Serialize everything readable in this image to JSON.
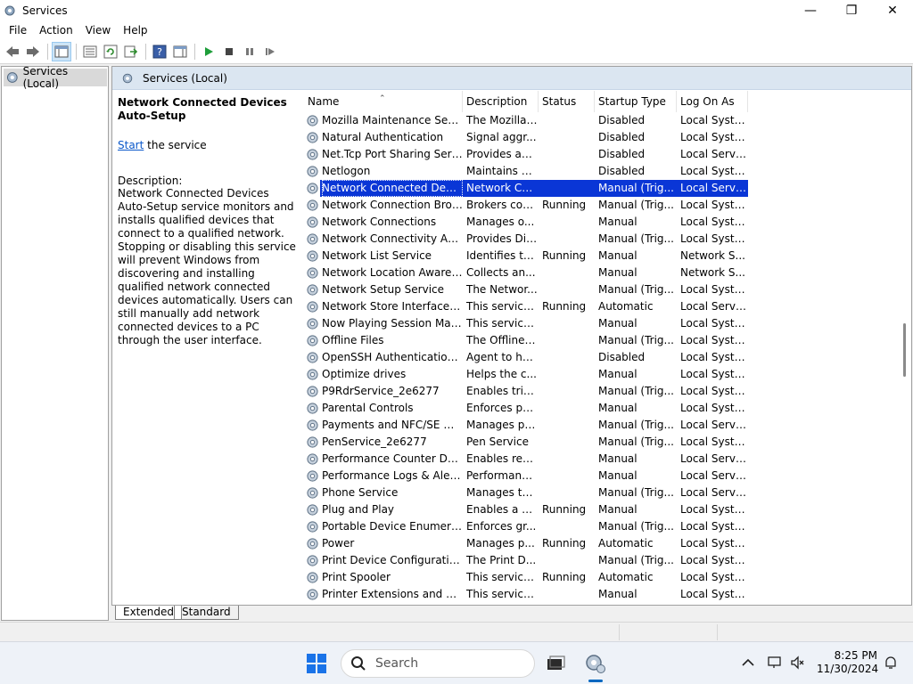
{
  "window": {
    "title": "Services"
  },
  "menu": [
    "File",
    "Action",
    "View",
    "Help"
  ],
  "tree": {
    "root_label": "Services (Local)"
  },
  "header": {
    "label": "Services (Local)"
  },
  "detail": {
    "service_name": "Network Connected Devices Auto-Setup",
    "action_link": "Start",
    "action_suffix": " the service",
    "description_label": "Description:",
    "description": "Network Connected Devices Auto-Setup service monitors and installs qualified devices that connect to a qualified network. Stopping or disabling this service will prevent Windows from discovering and installing qualified network connected devices automatically. Users can still manually add network connected devices to a PC through the user interface."
  },
  "columns": [
    "Name",
    "Description",
    "Status",
    "Startup Type",
    "Log On As"
  ],
  "rows": [
    {
      "name": "Mozilla Maintenance Service",
      "description": "The Mozilla ...",
      "status": "",
      "startup": "Disabled",
      "logon": "Local Syste..."
    },
    {
      "name": "Natural Authentication",
      "description": "Signal aggr...",
      "status": "",
      "startup": "Disabled",
      "logon": "Local Syste..."
    },
    {
      "name": "Net.Tcp Port Sharing Service",
      "description": "Provides abi...",
      "status": "",
      "startup": "Disabled",
      "logon": "Local Service"
    },
    {
      "name": "Netlogon",
      "description": "Maintains a ...",
      "status": "",
      "startup": "Disabled",
      "logon": "Local Syste..."
    },
    {
      "name": "Network Connected Device...",
      "description": "Network Co...",
      "status": "",
      "startup": "Manual (Trig...",
      "logon": "Local Service",
      "selected": true
    },
    {
      "name": "Network Connection Broker",
      "description": "Brokers con...",
      "status": "Running",
      "startup": "Manual (Trig...",
      "logon": "Local Syste..."
    },
    {
      "name": "Network Connections",
      "description": "Manages o...",
      "status": "",
      "startup": "Manual",
      "logon": "Local Syste..."
    },
    {
      "name": "Network Connectivity Assis...",
      "description": "Provides Dir...",
      "status": "",
      "startup": "Manual (Trig...",
      "logon": "Local Syste..."
    },
    {
      "name": "Network List Service",
      "description": "Identifies th...",
      "status": "Running",
      "startup": "Manual",
      "logon": "Network S..."
    },
    {
      "name": "Network Location Awareness",
      "description": "Collects an...",
      "status": "",
      "startup": "Manual",
      "logon": "Network S..."
    },
    {
      "name": "Network Setup Service",
      "description": "The Networ...",
      "status": "",
      "startup": "Manual (Trig...",
      "logon": "Local Syste..."
    },
    {
      "name": "Network Store Interface Ser...",
      "description": "This service ...",
      "status": "Running",
      "startup": "Automatic",
      "logon": "Local Service"
    },
    {
      "name": "Now Playing Session Mana...",
      "description": "This service ...",
      "status": "",
      "startup": "Manual",
      "logon": "Local Syste..."
    },
    {
      "name": "Offline Files",
      "description": "The Offline ...",
      "status": "",
      "startup": "Manual (Trig...",
      "logon": "Local Syste..."
    },
    {
      "name": "OpenSSH Authentication A...",
      "description": "Agent to ho...",
      "status": "",
      "startup": "Disabled",
      "logon": "Local Syste..."
    },
    {
      "name": "Optimize drives",
      "description": "Helps the c...",
      "status": "",
      "startup": "Manual",
      "logon": "Local Syste..."
    },
    {
      "name": "P9RdrService_2e6277",
      "description": "Enables trig...",
      "status": "",
      "startup": "Manual (Trig...",
      "logon": "Local Syste..."
    },
    {
      "name": "Parental Controls",
      "description": "Enforces pa...",
      "status": "",
      "startup": "Manual",
      "logon": "Local Syste..."
    },
    {
      "name": "Payments and NFC/SE Man...",
      "description": "Manages pa...",
      "status": "",
      "startup": "Manual (Trig...",
      "logon": "Local Service"
    },
    {
      "name": "PenService_2e6277",
      "description": "Pen Service",
      "status": "",
      "startup": "Manual (Trig...",
      "logon": "Local Syste..."
    },
    {
      "name": "Performance Counter DLL ...",
      "description": "Enables rem...",
      "status": "",
      "startup": "Manual",
      "logon": "Local Service"
    },
    {
      "name": "Performance Logs & Alerts",
      "description": "Performanc...",
      "status": "",
      "startup": "Manual",
      "logon": "Local Service"
    },
    {
      "name": "Phone Service",
      "description": "Manages th...",
      "status": "",
      "startup": "Manual (Trig...",
      "logon": "Local Service"
    },
    {
      "name": "Plug and Play",
      "description": "Enables a c...",
      "status": "Running",
      "startup": "Manual",
      "logon": "Local Syste..."
    },
    {
      "name": "Portable Device Enumerator...",
      "description": "Enforces gr...",
      "status": "",
      "startup": "Manual (Trig...",
      "logon": "Local Syste..."
    },
    {
      "name": "Power",
      "description": "Manages p...",
      "status": "Running",
      "startup": "Automatic",
      "logon": "Local Syste..."
    },
    {
      "name": "Print Device Configuration ...",
      "description": "The Print D...",
      "status": "",
      "startup": "Manual (Trig...",
      "logon": "Local Syste..."
    },
    {
      "name": "Print Spooler",
      "description": "This service ...",
      "status": "Running",
      "startup": "Automatic",
      "logon": "Local Syste..."
    },
    {
      "name": "Printer Extensions and Notif...",
      "description": "This service ...",
      "status": "",
      "startup": "Manual",
      "logon": "Local Syste..."
    }
  ],
  "tabs": [
    "Extended",
    "Standard"
  ],
  "taskbar": {
    "search_placeholder": "Search",
    "time": "8:25 PM",
    "date": "11/30/2024"
  },
  "colors": {
    "selection": "#0a36d6",
    "header_band": "#dbe6f1",
    "link": "#0a58ca"
  }
}
